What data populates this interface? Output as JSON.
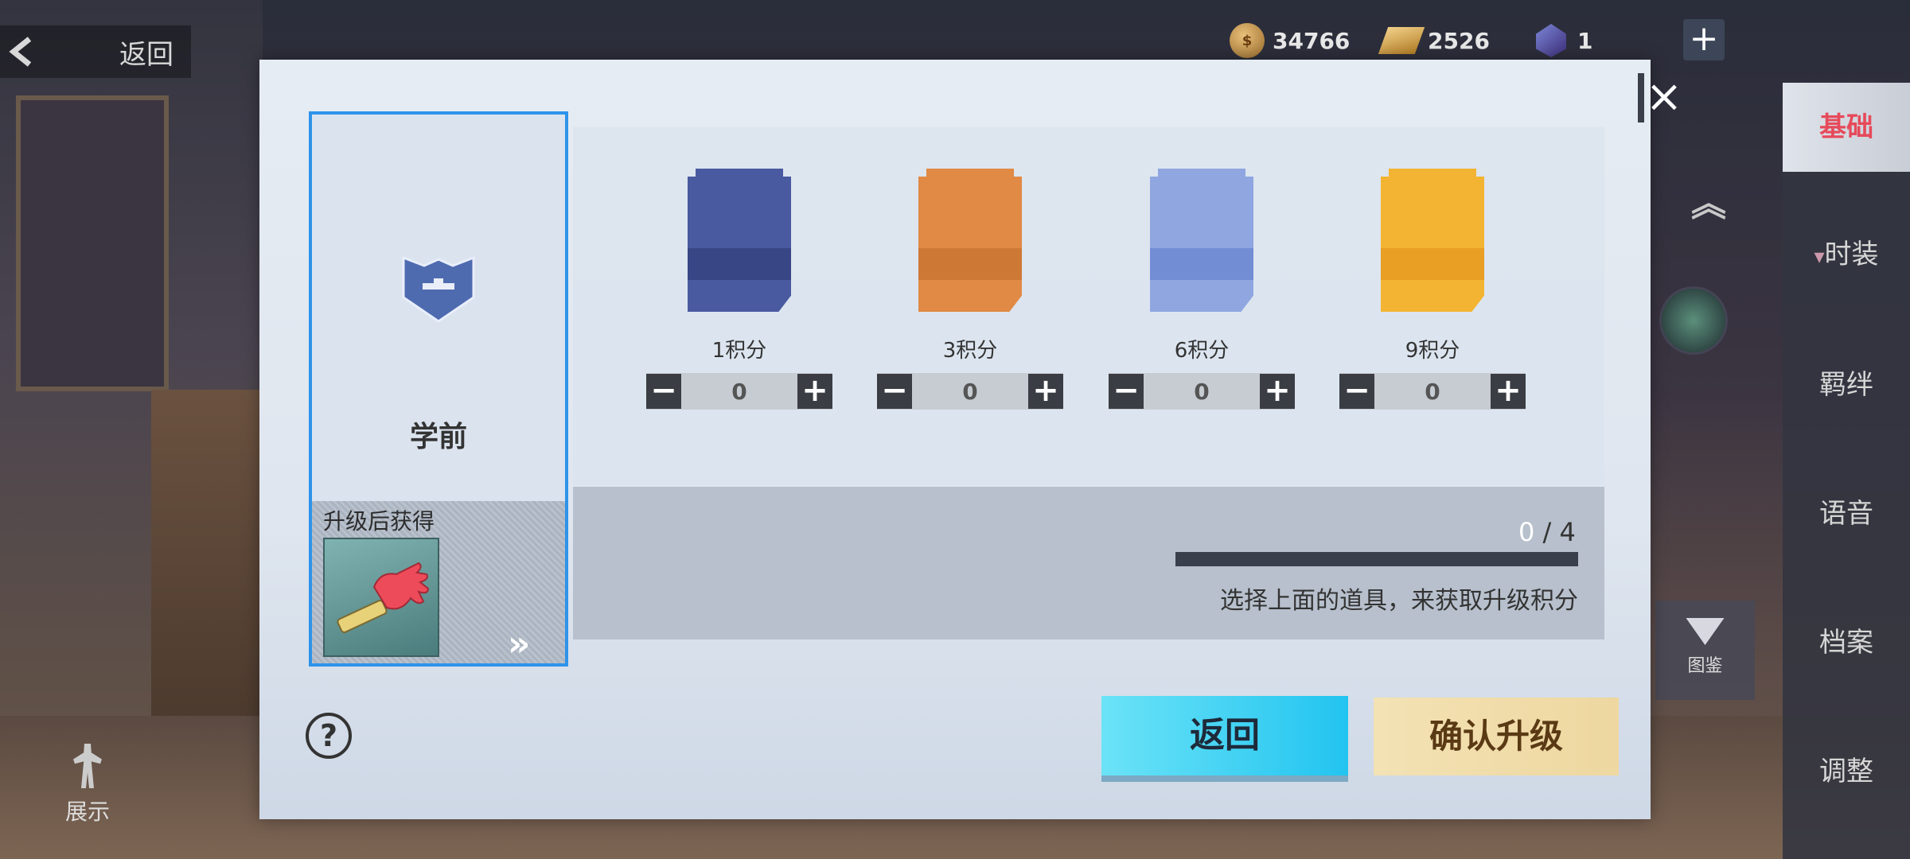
{
  "top": {
    "back_label": "返回",
    "currencies": [
      {
        "icon": "coin-icon",
        "value": "34766"
      },
      {
        "icon": "gold-bar-icon",
        "value": "2526"
      },
      {
        "icon": "gem-icon",
        "value": "1"
      }
    ]
  },
  "side_menu": {
    "items": [
      {
        "label": "基础",
        "active": true
      },
      {
        "label": "时装",
        "active": false
      },
      {
        "label": "羁绊",
        "active": false
      },
      {
        "label": "语音",
        "active": false
      },
      {
        "label": "档案",
        "active": false
      },
      {
        "label": "调整",
        "active": false
      }
    ],
    "atlas_label": "图鉴"
  },
  "bottom_left": {
    "show_label": "展示"
  },
  "dialog": {
    "rank_label": "学前",
    "reward_title": "升级后获得",
    "cards": [
      {
        "points_label": "1积分",
        "count": "0",
        "color": "#4a5aa0"
      },
      {
        "points_label": "3积分",
        "count": "0",
        "color": "#e08a45"
      },
      {
        "points_label": "6积分",
        "count": "0",
        "color": "#8fa6e0"
      },
      {
        "points_label": "9积分",
        "count": "0",
        "color": "#f2b432"
      }
    ],
    "progress": {
      "current": "0",
      "separator": " / ",
      "total": "4",
      "fraction": 0
    },
    "hint": "选择上面的道具，来获取升级积分",
    "back_button": "返回",
    "confirm_button": "确认升级"
  }
}
